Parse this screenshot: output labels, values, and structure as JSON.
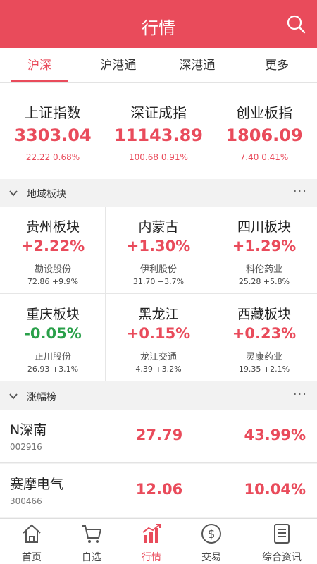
{
  "header": {
    "title": "行情"
  },
  "tabs": [
    {
      "label": "沪深"
    },
    {
      "label": "沪港通"
    },
    {
      "label": "深港通"
    },
    {
      "label": "更多"
    }
  ],
  "indices": [
    {
      "name": "上证指数",
      "value": "3303.04",
      "change": "22.22  0.68%"
    },
    {
      "name": "深证成指",
      "value": "11143.89",
      "change": "100.68  0.91%"
    },
    {
      "name": "创业板指",
      "value": "1806.09",
      "change": "7.40  0.41%"
    }
  ],
  "region_section": {
    "title": "地域板块",
    "more": "···"
  },
  "regions": [
    {
      "name": "贵州板块",
      "pct": "+2.22%",
      "stock": "勘设股份",
      "sub": "72.86  +9.9%"
    },
    {
      "name": "内蒙古",
      "pct": "+1.30%",
      "stock": "伊利股份",
      "sub": "31.70  +3.7%"
    },
    {
      "name": "四川板块",
      "pct": "+1.29%",
      "stock": "科伦药业",
      "sub": "25.28  +5.8%"
    },
    {
      "name": "重庆板块",
      "pct": "-0.05%",
      "stock": "正川股份",
      "sub": "26.93  +3.1%"
    },
    {
      "name": "黑龙江",
      "pct": "+0.15%",
      "stock": "龙江交通",
      "sub": "4.39  +3.2%"
    },
    {
      "name": "西藏板块",
      "pct": "+0.23%",
      "stock": "灵康药业",
      "sub": "19.35  +2.1%"
    }
  ],
  "gainers_section": {
    "title": "涨幅榜",
    "more": "···"
  },
  "gainers": [
    {
      "name": "N深南",
      "code": "002916",
      "price": "27.79",
      "pct": "43.99%"
    },
    {
      "name": "赛摩电气",
      "code": "300466",
      "price": "12.06",
      "pct": "10.04%"
    }
  ],
  "tabbar": [
    {
      "label": "首页",
      "icon": "home-icon"
    },
    {
      "label": "自选",
      "icon": "cart-icon"
    },
    {
      "label": "行情",
      "icon": "chart-icon"
    },
    {
      "label": "交易",
      "icon": "dollar-icon"
    },
    {
      "label": "综合资讯",
      "icon": "news-icon"
    }
  ],
  "colors": {
    "accent": "#e94b5b",
    "down": "#2aa04a"
  }
}
